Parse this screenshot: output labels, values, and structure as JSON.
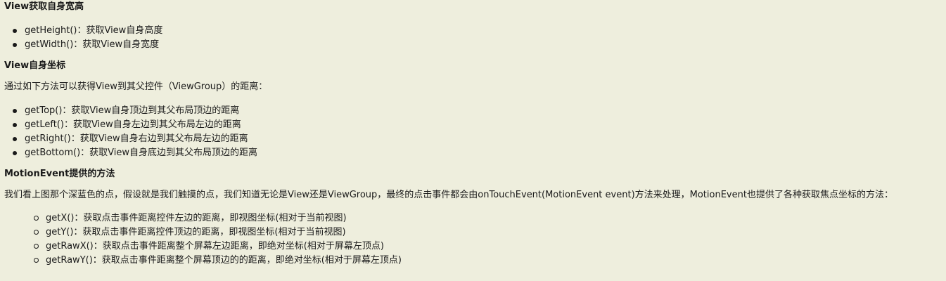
{
  "sections": {
    "view_size": {
      "heading": "View获取自身宽高",
      "items": [
        "getHeight()：获取View自身高度",
        "getWidth()：获取View自身宽度"
      ]
    },
    "view_coords": {
      "heading": "View自身坐标",
      "intro": "通过如下方法可以获得View到其父控件（ViewGroup）的距离：",
      "items": [
        "getTop()：获取View自身顶边到其父布局顶边的距离",
        "getLeft()：获取View自身左边到其父布局左边的距离",
        "getRight()：获取View自身右边到其父布局左边的距离",
        "getBottom()：获取View自身底边到其父布局顶边的距离"
      ]
    },
    "motion_event": {
      "heading": "MotionEvent提供的方法",
      "intro": "我们看上图那个深蓝色的点，假设就是我们触摸的点，我们知道无论是View还是ViewGroup，最终的点击事件都会由onTouchEvent(MotionEvent event)方法来处理，MotionEvent也提供了各种获取焦点坐标的方法：",
      "items": [
        "getX()：获取点击事件距离控件左边的距离，即视图坐标(相对于当前视图)",
        "getY()：获取点击事件距离控件顶边的距离，即视图坐标(相对于当前视图)",
        "getRawX()：获取点击事件距离整个屏幕左边距离，即绝对坐标(相对于屏幕左顶点)",
        "getRawY()：获取点击事件距离整个屏幕顶边的的距离，即绝对坐标(相对于屏幕左顶点)"
      ]
    }
  },
  "colors": {
    "background": "#eeeedd",
    "text": "#1a1a1a"
  }
}
